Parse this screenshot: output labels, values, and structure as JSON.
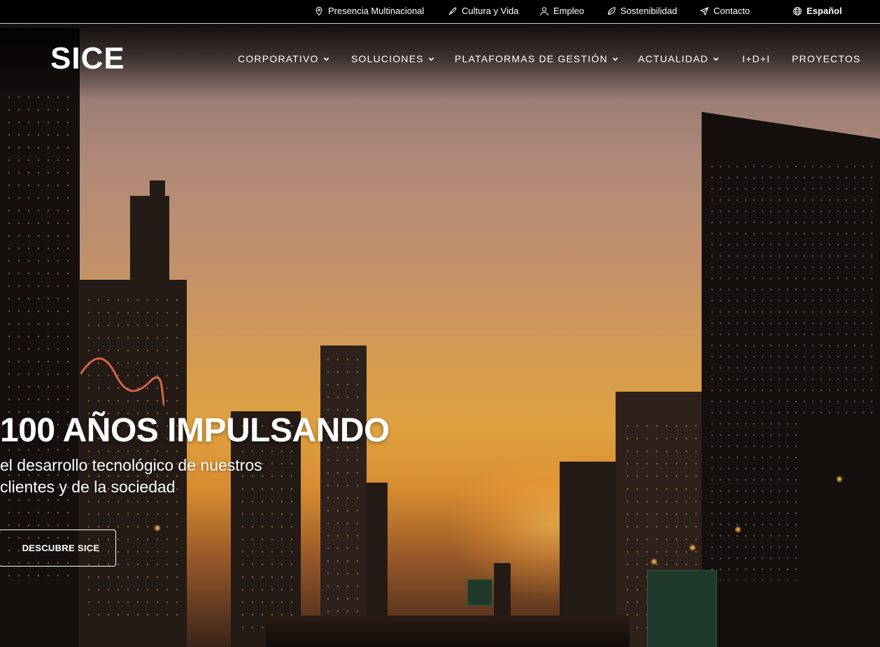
{
  "utility_bar": {
    "items": [
      {
        "label": "Presencia Multinacional",
        "icon": "map-pin-icon"
      },
      {
        "label": "Cultura y Vida",
        "icon": "rocket-icon"
      },
      {
        "label": "Empleo",
        "icon": "user-icon"
      },
      {
        "label": "Sostenibilidad",
        "icon": "leaf-icon"
      },
      {
        "label": "Contacto",
        "icon": "paper-plane-icon"
      }
    ],
    "language": {
      "label": "Español",
      "icon": "globe-icon"
    }
  },
  "brand": {
    "name": "SICE",
    "logo_colors": [
      "#2ad6a6",
      "#1ab6d8"
    ]
  },
  "nav": {
    "items": [
      {
        "label": "CORPORATIVO",
        "has_dropdown": true
      },
      {
        "label": "SOLUCIONES",
        "has_dropdown": true
      },
      {
        "label": "PLATAFORMAS DE GESTIÓN",
        "has_dropdown": true
      },
      {
        "label": "ACTUALIDAD",
        "has_dropdown": true
      },
      {
        "label": "I+D+I",
        "has_dropdown": false
      },
      {
        "label": "PROYECTOS",
        "has_dropdown": false
      }
    ]
  },
  "hero": {
    "headline": "100 AÑOS IMPULSANDO",
    "subline_1": "el desarrollo tecnológico de nuestros",
    "subline_2": "clientes y de la sociedad",
    "cta_label": "DESCUBRE SICE"
  },
  "colors": {
    "topbar_bg": "#000000",
    "accent_teal": "#2ad6a6",
    "text": "#ffffff"
  }
}
